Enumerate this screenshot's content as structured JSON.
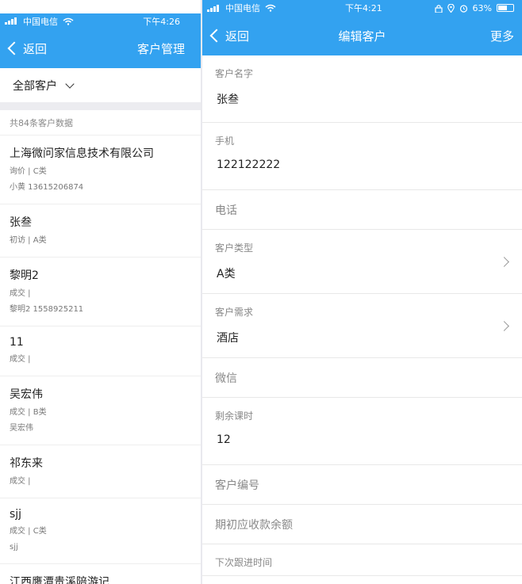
{
  "left": {
    "status": {
      "carrier": "中国电信",
      "time": "下午4:26"
    },
    "nav": {
      "back": "返回",
      "title": "客户管理"
    },
    "filter": {
      "label": "全部客户"
    },
    "count": "共84条客户数据",
    "customers": [
      {
        "name": "上海微问家信息技术有限公司",
        "line1": "询价 | C类",
        "line2": "小黄 13615206874"
      },
      {
        "name": "张叁",
        "line1": "初访 | A类",
        "line2": ""
      },
      {
        "name": "黎明2",
        "line1": "成交 |",
        "line2": "黎明2 1558925211"
      },
      {
        "name": "11",
        "line1": "成交 |",
        "line2": ""
      },
      {
        "name": "吴宏伟",
        "line1": "成交 | B类",
        "line2": "吴宏伟"
      },
      {
        "name": "祁东来",
        "line1": "成交 |",
        "line2": ""
      },
      {
        "name": "sjj",
        "line1": "成交 | C类",
        "line2": "sjj"
      },
      {
        "name": "江西鹰潭贵溪陪游记",
        "line1": "",
        "line2": ""
      }
    ]
  },
  "right": {
    "status": {
      "carrier": "中国电信",
      "time": "下午4:21",
      "battery": "63%",
      "battery_level": 0.63
    },
    "nav": {
      "back": "返回",
      "title": "编辑客户",
      "more": "更多"
    },
    "fields": {
      "name": {
        "label": "客户名字",
        "value": "张叁"
      },
      "mobile": {
        "label": "手机",
        "value": "122122222"
      },
      "phone": {
        "label": "电话"
      },
      "type": {
        "label": "客户类型",
        "value": "A类"
      },
      "demand": {
        "label": "客户需求",
        "value": "酒店"
      },
      "wechat": {
        "label": "微信"
      },
      "remaining": {
        "label": "剩余课时",
        "value": "12"
      },
      "code": {
        "label": "客户编号"
      },
      "balance": {
        "label": "期初应收款余额"
      },
      "next_follow": {
        "label": "下次跟进时间"
      }
    }
  },
  "colors": {
    "primary": "#33a2f0",
    "band": "#ececf0"
  }
}
